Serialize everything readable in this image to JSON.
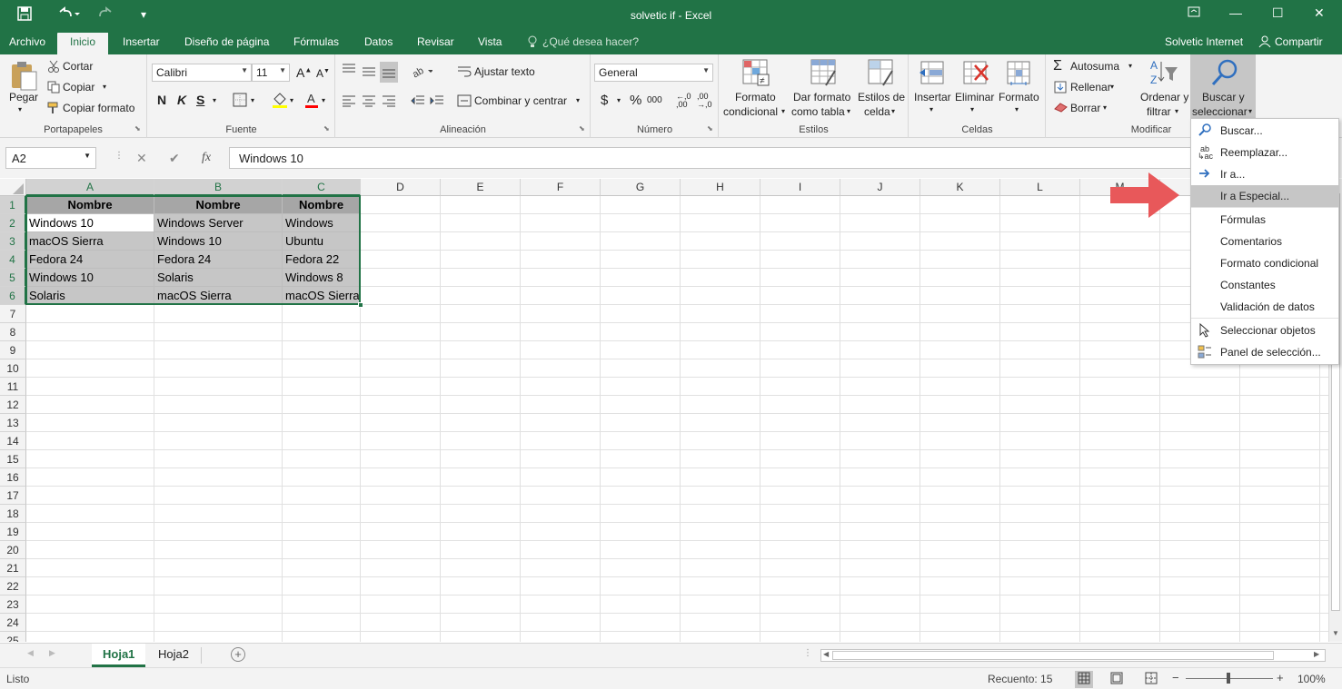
{
  "window": {
    "title": "solvetic if - Excel",
    "user": "Solvetic Internet",
    "share_label": "Compartir"
  },
  "tabs": [
    "Archivo",
    "Inicio",
    "Insertar",
    "Diseño de página",
    "Fórmulas",
    "Datos",
    "Revisar",
    "Vista"
  ],
  "tell_me": "¿Qué desea hacer?",
  "ribbon": {
    "clipboard": {
      "paste": "Pegar",
      "cut": "Cortar",
      "copy": "Copiar",
      "format_painter": "Copiar formato",
      "label": "Portapapeles"
    },
    "font": {
      "name": "Calibri",
      "size": "11",
      "bold": "N",
      "italic": "K",
      "underline": "S",
      "label": "Fuente"
    },
    "alignment": {
      "wrap": "Ajustar texto",
      "merge": "Combinar y centrar",
      "label": "Alineación"
    },
    "number": {
      "format": "General",
      "currency": "$",
      "percent": "%",
      "thousands": "000",
      "label": "Número"
    },
    "styles": {
      "conditional_1": "Formato",
      "conditional_2": "condicional",
      "table_1": "Dar formato",
      "table_2": "como tabla",
      "cell_1": "Estilos de",
      "cell_2": "celda",
      "label": "Estilos"
    },
    "cells": {
      "insert": "Insertar",
      "delete": "Eliminar",
      "format": "Formato",
      "label": "Celdas"
    },
    "editing": {
      "autosum": "Autosuma",
      "fill": "Rellenar",
      "clear": "Borrar",
      "sort_1": "Ordenar y",
      "sort_2": "filtrar",
      "find_1": "Buscar y",
      "find_2": "seleccionar",
      "label": "Modificar"
    }
  },
  "formula_bar": {
    "name_box": "A2",
    "fx": "fx",
    "value": "Windows 10"
  },
  "columns": [
    "A",
    "B",
    "C",
    "D",
    "E",
    "F",
    "G",
    "H",
    "I",
    "J",
    "K",
    "L",
    "M",
    "N",
    "O",
    "P"
  ],
  "rows": [
    "1",
    "2",
    "3",
    "4",
    "5",
    "6",
    "7",
    "8",
    "9",
    "10",
    "11",
    "12",
    "13",
    "14",
    "15",
    "16",
    "17",
    "18",
    "19",
    "20",
    "21",
    "22",
    "23",
    "24",
    "25"
  ],
  "table": {
    "headers": [
      "Nombre",
      "Nombre",
      "Nombre"
    ],
    "data": [
      [
        "Windows 10",
        "Windows Server",
        "Windows"
      ],
      [
        "macOS Sierra",
        "Windows 10",
        "Ubuntu"
      ],
      [
        "Fedora 24",
        "Fedora 24",
        "Fedora 22"
      ],
      [
        "Windows 10",
        "Solaris",
        "Windows 8"
      ],
      [
        "Solaris",
        "macOS Sierra",
        "macOS Sierra"
      ]
    ]
  },
  "menu": {
    "items": [
      "Buscar...",
      "Reemplazar...",
      "Ir a...",
      "Ir a Especial...",
      "Fórmulas",
      "Comentarios",
      "Formato condicional",
      "Constantes",
      "Validación de datos",
      "Seleccionar objetos",
      "Panel de selección..."
    ],
    "highlighted": "Ir a Especial...",
    "icons": [
      "search-icon",
      "replace-icon",
      "goto-arrow-icon",
      "",
      "",
      "",
      "",
      "",
      "",
      "pointer-icon",
      "selection-pane-icon"
    ]
  },
  "sheets": [
    "Hoja1",
    "Hoja2"
  ],
  "active_sheet": "Hoja1",
  "status": {
    "ready": "Listo",
    "count": "Recuento: 15",
    "zoom": "100%"
  },
  "colors": {
    "accent": "#217346",
    "selection_fill": "#c6c6c6",
    "arrow": "#e8585a"
  }
}
